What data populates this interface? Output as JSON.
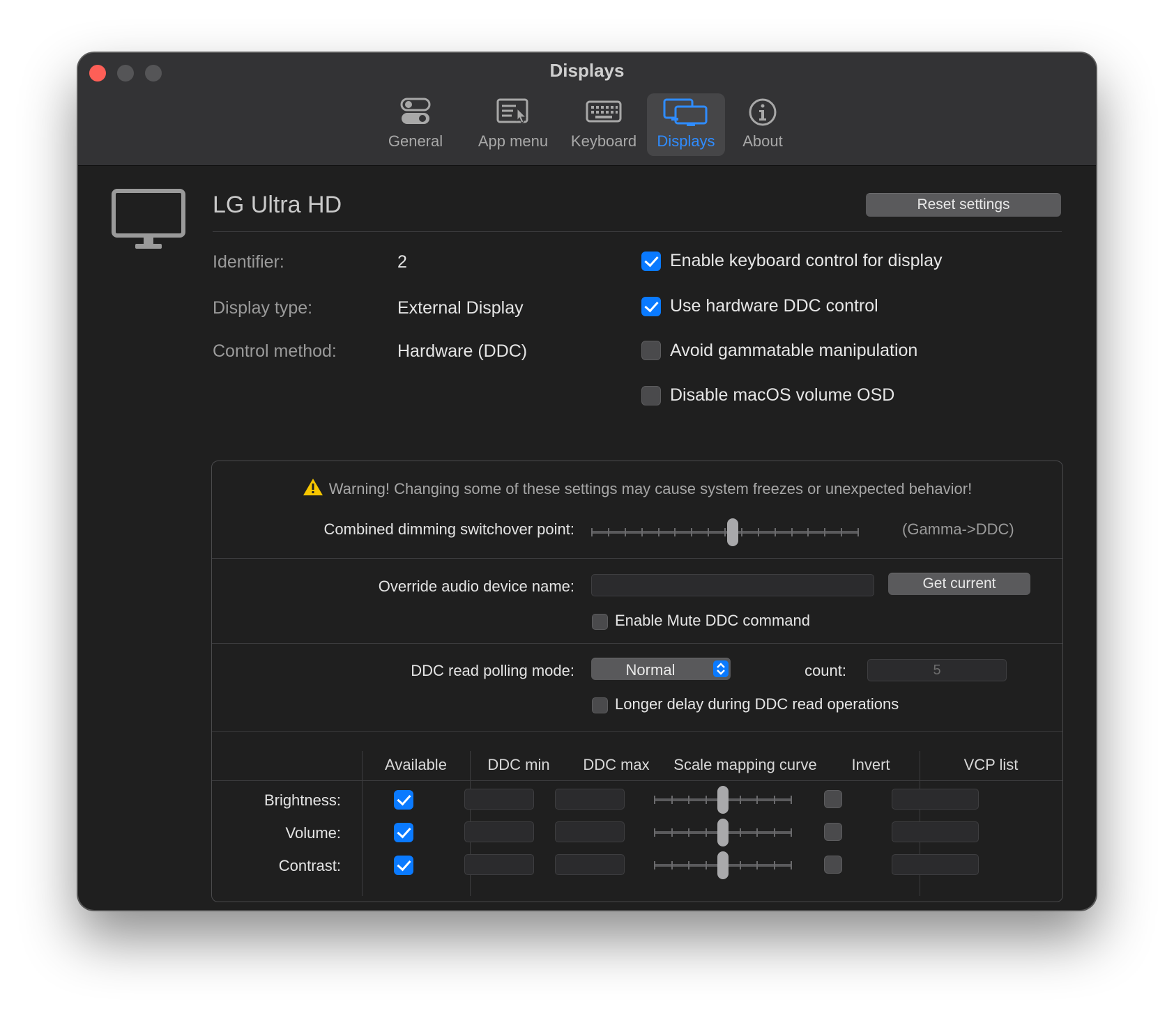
{
  "window": {
    "title": "Displays"
  },
  "toolbar": {
    "items": [
      {
        "label": "General",
        "icon": "toggles-icon"
      },
      {
        "label": "App menu",
        "icon": "app-menu-icon"
      },
      {
        "label": "Keyboard",
        "icon": "keyboard-icon"
      },
      {
        "label": "Displays",
        "icon": "displays-icon",
        "active": true
      },
      {
        "label": "About",
        "icon": "info-icon"
      }
    ],
    "active_color": "#2f8cff"
  },
  "display": {
    "name": "LG Ultra HD",
    "reset_label": "Reset settings",
    "info": [
      {
        "key": "Identifier:",
        "value": "2"
      },
      {
        "key": "Display type:",
        "value": "External Display"
      },
      {
        "key": "Control method:",
        "value": "Hardware (DDC)"
      }
    ],
    "options": [
      {
        "label": "Enable keyboard control for display",
        "checked": true
      },
      {
        "label": "Use hardware DDC control",
        "checked": true
      },
      {
        "label": "Avoid gammatable manipulation",
        "checked": false
      },
      {
        "label": "Disable macOS volume OSD",
        "checked": false
      }
    ]
  },
  "advanced": {
    "warning": "Warning! Changing some of these settings may cause system freezes or unexpected behavior!",
    "switchover": {
      "label": "Combined dimming switchover point:",
      "hint": "(Gamma->DDC)",
      "value_fraction": 0.53
    },
    "audio": {
      "label": "Override audio device name:",
      "value": "",
      "button": "Get current"
    },
    "mute": {
      "label": "Enable Mute DDC command",
      "checked": false
    },
    "polling": {
      "label": "DDC read polling mode:",
      "selected": "Normal",
      "count_label": "count:",
      "count_value": "5"
    },
    "longer_delay": {
      "label": "Longer delay during DDC read operations",
      "checked": false
    },
    "table": {
      "headers": [
        "Available",
        "DDC min",
        "DDC max",
        "Scale mapping curve",
        "Invert",
        "VCP list"
      ],
      "rows": [
        {
          "label": "Brightness:",
          "available": true,
          "invert": false,
          "curve_fraction": 0.5
        },
        {
          "label": "Volume:",
          "available": true,
          "invert": false,
          "curve_fraction": 0.5
        },
        {
          "label": "Contrast:",
          "available": true,
          "invert": false,
          "curve_fraction": 0.5
        }
      ]
    }
  },
  "colors": {
    "accent": "#0a7aff",
    "close": "#fe5f57",
    "warning": "#f7c600"
  }
}
